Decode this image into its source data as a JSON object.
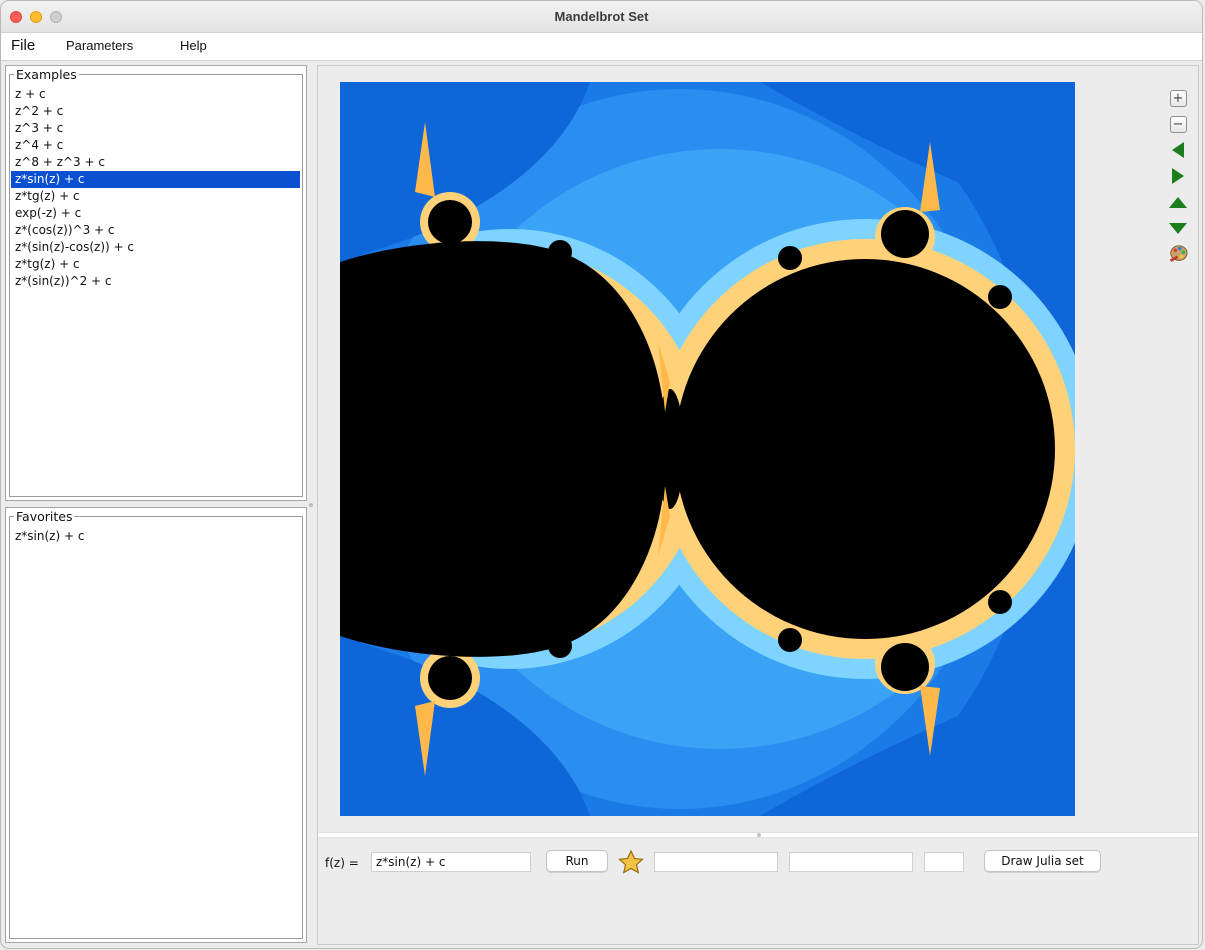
{
  "window": {
    "title": "Mandelbrot Set"
  },
  "menu": {
    "file": "File",
    "parameters": "Parameters",
    "help": "Help"
  },
  "examples": {
    "title": "Examples",
    "selected_index": 5,
    "items": [
      "z + c",
      "z^2 + c",
      "z^3 + c",
      "z^4 + c",
      "z^8 + z^3 + c",
      "z*sin(z) + c",
      "z*tg(z) + c",
      "exp(-z) + c",
      "z*(cos(z))^3 + c",
      "z*(sin(z)-cos(z)) + c",
      "z*tg(z) + c",
      "z*(sin(z))^2 + c"
    ]
  },
  "favorites": {
    "title": "Favorites",
    "items": [
      "z*sin(z) + c"
    ]
  },
  "toolbar": {
    "icons": [
      "zoom-in-icon",
      "zoom-out-icon",
      "pan-left-icon",
      "pan-right-icon",
      "pan-up-icon",
      "pan-down-icon",
      "palette-icon"
    ]
  },
  "controls": {
    "fz_label": "f(z) =",
    "function_value": "z*sin(z) + c",
    "run_label": "Run",
    "field_a_value": "",
    "field_b_value": "",
    "field_c_value": "",
    "julia_label": "Draw Julia set"
  },
  "colors": {
    "selection": "#0b50d0",
    "fractal_background": "#0e66d8",
    "fractal_set": "#000000",
    "arrow_green": "#1d7d1d"
  }
}
